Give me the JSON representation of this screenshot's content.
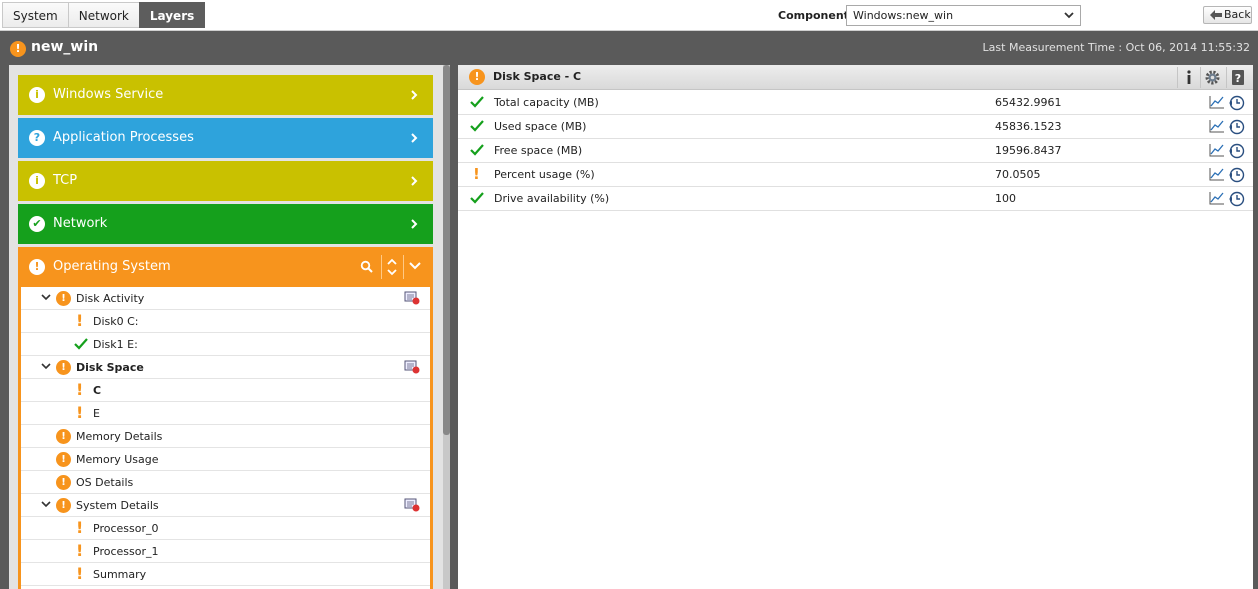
{
  "tabs": [
    {
      "label": "System",
      "active": false
    },
    {
      "label": "Network",
      "active": false
    },
    {
      "label": "Layers",
      "active": true
    }
  ],
  "component": {
    "label": "Component",
    "value": "Windows:new_win"
  },
  "back_label": "Back",
  "page_title": "new_win",
  "measurement_time": "Last Measurement Time : Oct 06, 2014 11:55:32",
  "layers": [
    {
      "label": "Windows Service",
      "icon": "info-icon",
      "glyph": "i",
      "color": "#c9c100"
    },
    {
      "label": "Application Processes",
      "icon": "question-icon",
      "glyph": "?",
      "color": "#2ea3dc"
    },
    {
      "label": "TCP",
      "icon": "info-icon",
      "glyph": "i",
      "color": "#c9c100"
    },
    {
      "label": "Network",
      "icon": "check-icon",
      "glyph": "✔",
      "color": "#15a01c"
    },
    {
      "label": "Operating System",
      "icon": "warning-icon",
      "glyph": "!",
      "color": "#f7941d"
    }
  ],
  "tree": [
    {
      "label": "Disk Activity",
      "level": 1,
      "status": "warning",
      "expanded": true,
      "bold": false
    },
    {
      "label": "Disk0 C:",
      "level": 2,
      "status": "warning",
      "bold": false
    },
    {
      "label": "Disk1 E:",
      "level": 2,
      "status": "ok",
      "bold": false
    },
    {
      "label": "Disk Space",
      "level": 1,
      "status": "warning",
      "expanded": true,
      "bold": true
    },
    {
      "label": "C",
      "level": 2,
      "status": "warning",
      "bold": true
    },
    {
      "label": "E",
      "level": 2,
      "status": "warning",
      "bold": false
    },
    {
      "label": "Memory Details",
      "level": 1,
      "status": "warning",
      "bold": false
    },
    {
      "label": "Memory Usage",
      "level": 1,
      "status": "warning",
      "bold": false
    },
    {
      "label": "OS Details",
      "level": 1,
      "status": "warning",
      "bold": false
    },
    {
      "label": "System Details",
      "level": 1,
      "status": "warning",
      "expanded": true,
      "bold": false
    },
    {
      "label": "Processor_0",
      "level": 2,
      "status": "warning",
      "bold": false
    },
    {
      "label": "Processor_1",
      "level": 2,
      "status": "warning",
      "bold": false
    },
    {
      "label": "Summary",
      "level": 2,
      "status": "warning",
      "bold": false
    }
  ],
  "detail": {
    "title": "Disk Space - C",
    "tools": [
      "info-icon",
      "gear-icon",
      "help-icon"
    ],
    "metrics": [
      {
        "name": "Total capacity (MB)",
        "value": "65432.9961",
        "status": "ok"
      },
      {
        "name": "Used space (MB)",
        "value": "45836.1523",
        "status": "ok"
      },
      {
        "name": "Free space (MB)",
        "value": "19596.8437",
        "status": "ok"
      },
      {
        "name": "Percent usage (%)",
        "value": "70.0505",
        "status": "warning"
      },
      {
        "name": "Drive availability (%)",
        "value": "100",
        "status": "ok"
      }
    ]
  },
  "colors": {
    "warning": "#f7941d",
    "ok": "#15a01c",
    "header": "#5a5a5a"
  }
}
